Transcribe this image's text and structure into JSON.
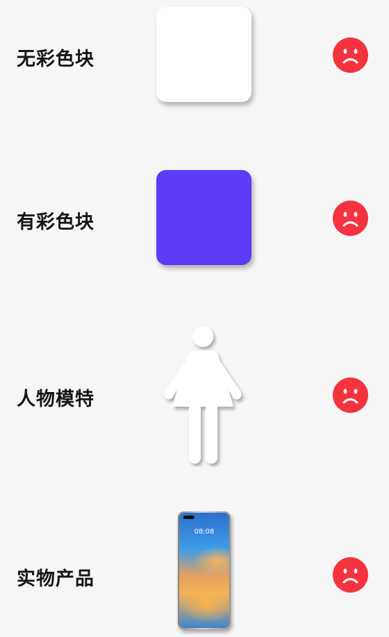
{
  "rows": [
    {
      "label": "无彩色块",
      "visual": "white-square",
      "status_icon": "sad-face-icon"
    },
    {
      "label": "有彩色块",
      "visual": "purple-square",
      "status_icon": "sad-face-icon"
    },
    {
      "label": "人物模特",
      "visual": "female-figure-icon",
      "status_icon": "sad-face-icon"
    },
    {
      "label": "实物产品",
      "visual": "smartphone",
      "status_icon": "sad-face-icon"
    }
  ],
  "phone": {
    "time": "08:08"
  },
  "colors": {
    "background": "#f6f6f6",
    "white_square": "#ffffff",
    "purple_square": "#5e3bf7",
    "sad_face": "#f5333f",
    "label": "#151515"
  }
}
